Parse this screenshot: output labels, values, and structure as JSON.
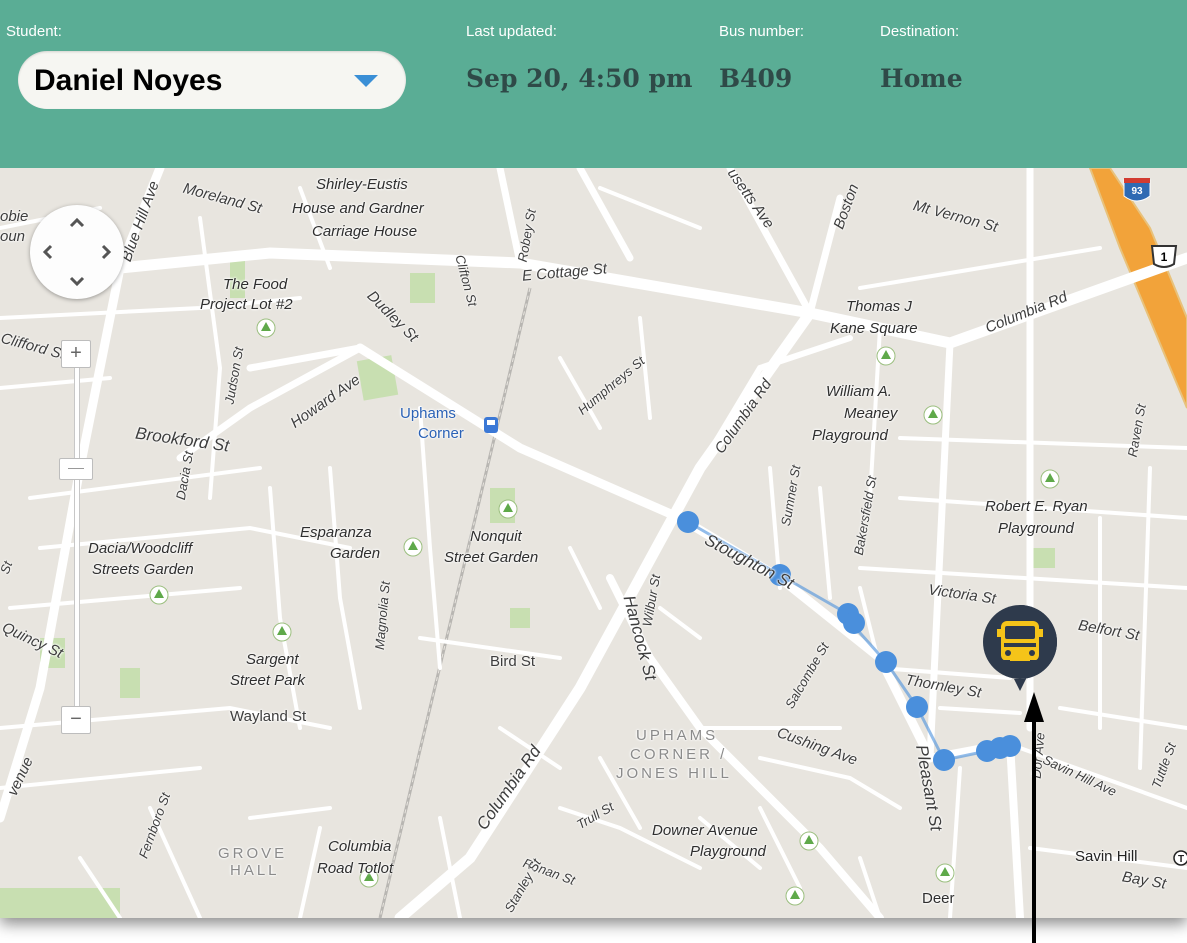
{
  "header": {
    "student_label": "Student:",
    "student_value": "Daniel Noyes",
    "last_updated_label": "Last updated:",
    "last_updated_value": "Sep 20, 4:50 pm",
    "bus_number_label": "Bus number:",
    "bus_number_value": "B409",
    "destination_label": "Destination:",
    "destination_value": "Home"
  },
  "map": {
    "zoom_in": "+",
    "zoom_out": "−",
    "pan_up": "⌃",
    "highway_shields": [
      "93",
      "1"
    ],
    "labels": {
      "blue_hill_ave": "Blue Hill Ave",
      "moreland_st": "Moreland St",
      "shirley_eustis": "Shirley-Eustis",
      "shirley_eustis_2": "House and Gardner",
      "shirley_eustis_3": "Carriage House",
      "robey_st": "Robey St",
      "usetts_ave": "usetts Ave",
      "boston": "Boston",
      "mt_vernon": "Mt Vernon St",
      "e_cottage": "E Cottage St",
      "columbia_rd_top": "Columbia Rd",
      "food_project_1": "The Food",
      "food_project_2": "Project Lot #2",
      "dudley_st": "Dudley St",
      "clifton_st": "Clifton St",
      "thomas_kane_1": "Thomas J",
      "thomas_kane_2": "Kane Square",
      "clifford_st": "Clifford St",
      "judson_st": "Judson St",
      "howard_ave": "Howard Ave",
      "humphreys_st": "Humphreys St",
      "columbia_rd_mid": "Columbia Rd",
      "william_meaney_1": "William A.",
      "william_meaney_2": "Meaney",
      "william_meaney_3": "Playground",
      "uphams_corner_1": "Uphams",
      "uphams_corner_2": "Corner",
      "brookford_st": "Brookford St",
      "dacia_st": "Dacia St",
      "sumner_st": "Sumner St",
      "bakersfield_st": "Bakersfield St",
      "raven_st": "Raven St",
      "robert_ryan_1": "Robert E. Ryan",
      "robert_ryan_2": "Playground",
      "esparanza_1": "Esparanza",
      "esparanza_2": "Garden",
      "nonquit_1": "Nonquit",
      "nonquit_2": "Street Garden",
      "dacia_woodcliff_1": "Dacia/Woodcliff",
      "dacia_woodcliff_2": "Streets Garden",
      "stoughton_st": "Stoughton St",
      "wilbur_st": "Wilbur St",
      "victoria_st": "Victoria St",
      "belfort_st": "Belfort St",
      "hancock_st": "Hancock St",
      "magnolia_st": "Magnolia St",
      "quincy_st": "Quincy St",
      "sargent_1": "Sargent",
      "sargent_2": "Street Park",
      "bird_st": "Bird St",
      "salcombe_st": "Salcombe St",
      "thornley_st": "Thornley St",
      "wayland_st": "Wayland St",
      "pleasant_st": "Pleasant St",
      "dorchester_ave": "Dor Ave",
      "uphams_area_1": "UPHAMS",
      "uphams_area_2": "CORNER /",
      "uphams_area_3": "JONES HILL",
      "cushing_ave": "Cushing Ave",
      "savin_hill_ave": "Savin Hill Ave",
      "tuttle_st": "Tuttle St",
      "columbia_rd_bottom": "Columbia Rd",
      "trull_st": "Trull St",
      "downer_1": "Downer Avenue",
      "downer_2": "Playground",
      "savin_hill": "Savin Hill",
      "bay_st": "Bay St",
      "fernboro_st": "Fernboro St",
      "grove_1": "GROVE",
      "grove_2": "HALL",
      "columbia_totlot_1": "Columbia",
      "columbia_totlot_2": "Road Totlot",
      "ronan_st": "Ronan St",
      "stanley_st": "Stanley St",
      "deer": "Deer",
      "avenue_left": "venue",
      "st_left": "St",
      "bie_left": "obie",
      "oun_left": "oun"
    }
  },
  "colors": {
    "header_bg": "#5aad95",
    "header_value_text": "#2f4a48",
    "route_stop": "#4a8fdc",
    "bus_marker_bg": "#2e3a4c",
    "bus_yellow": "#f5c419",
    "map_bg": "#e8e5df",
    "road": "#ffffff",
    "park": "#c8dfb1",
    "highway": "#f2a33a"
  }
}
